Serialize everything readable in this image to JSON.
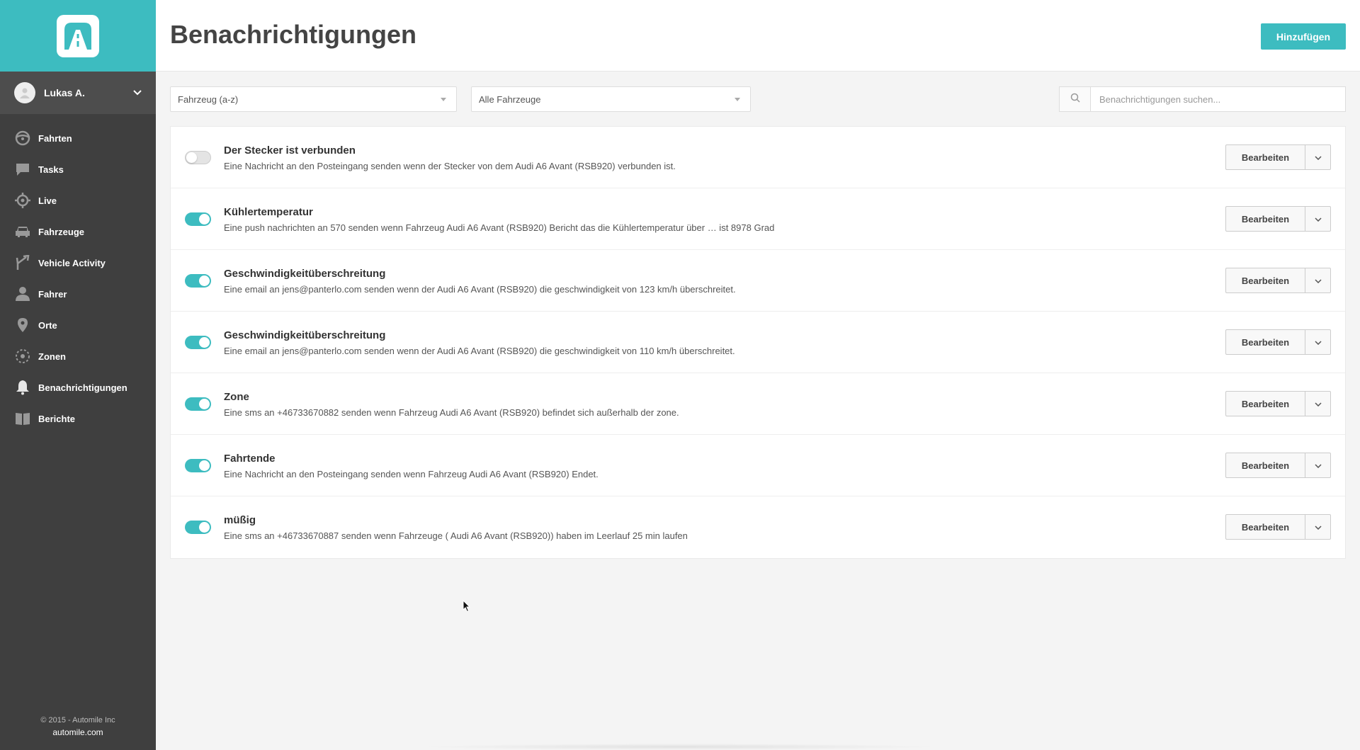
{
  "sidebar": {
    "user_name": "Lukas A.",
    "items": [
      {
        "label": "Fahrten",
        "icon": "steering-wheel-icon"
      },
      {
        "label": "Tasks",
        "icon": "chat-bubble-icon"
      },
      {
        "label": "Live",
        "icon": "crosshair-icon"
      },
      {
        "label": "Fahrzeuge",
        "icon": "car-icon"
      },
      {
        "label": "Vehicle Activity",
        "icon": "route-split-icon"
      },
      {
        "label": "Fahrer",
        "icon": "person-icon"
      },
      {
        "label": "Orte",
        "icon": "map-pin-icon"
      },
      {
        "label": "Zonen",
        "icon": "zone-circle-icon"
      },
      {
        "label": "Benachrichtigungen",
        "icon": "bell-icon",
        "active": true
      },
      {
        "label": "Berichte",
        "icon": "book-icon"
      }
    ],
    "footer": {
      "copyright": "© 2015 - Automile Inc",
      "site": "automile.com"
    }
  },
  "header": {
    "title": "Benachrichtigungen",
    "add_label": "Hinzufügen"
  },
  "filters": {
    "sort_selected": "Fahrzeug (a-z)",
    "vehicle_selected": "Alle Fahrzeuge",
    "search_placeholder": "Benachrichtigungen suchen..."
  },
  "notifications": [
    {
      "enabled": false,
      "title": "Der Stecker ist verbunden",
      "description": "Eine Nachricht an den Posteingang senden wenn der Stecker von dem Audi A6 Avant (RSB920) verbunden ist."
    },
    {
      "enabled": true,
      "title": "Kühlertemperatur",
      "description": "Eine push nachrichten an 570 senden wenn Fahrzeug Audi A6 Avant (RSB920) Bericht das die Kühlertemperatur über … ist 8978 Grad"
    },
    {
      "enabled": true,
      "title": "Geschwindigkeitüberschreitung",
      "description": "Eine email an jens@panterlo.com senden wenn der Audi A6 Avant (RSB920) die geschwindigkeit von 123 km/h überschreitet."
    },
    {
      "enabled": true,
      "title": "Geschwindigkeitüberschreitung",
      "description": "Eine email an jens@panterlo.com senden wenn der Audi A6 Avant (RSB920) die geschwindigkeit von 110 km/h überschreitet."
    },
    {
      "enabled": true,
      "title": "Zone",
      "description": "Eine sms an +46733670882 senden wenn Fahrzeug Audi A6 Avant (RSB920) befindet sich außerhalb der zone."
    },
    {
      "enabled": true,
      "title": "Fahrtende",
      "description": "Eine Nachricht an den Posteingang senden wenn Fahrzeug Audi A6 Avant (RSB920) Endet."
    },
    {
      "enabled": true,
      "title": "müßig",
      "description": "Eine sms an +46733670887 senden wenn Fahrzeuge ( Audi A6 Avant (RSB920)) haben im Leerlauf 25 min laufen"
    }
  ],
  "row_actions": {
    "edit_label": "Bearbeiten"
  },
  "colors": {
    "accent": "#3dbcc0",
    "sidebar": "#3f3f3f"
  }
}
